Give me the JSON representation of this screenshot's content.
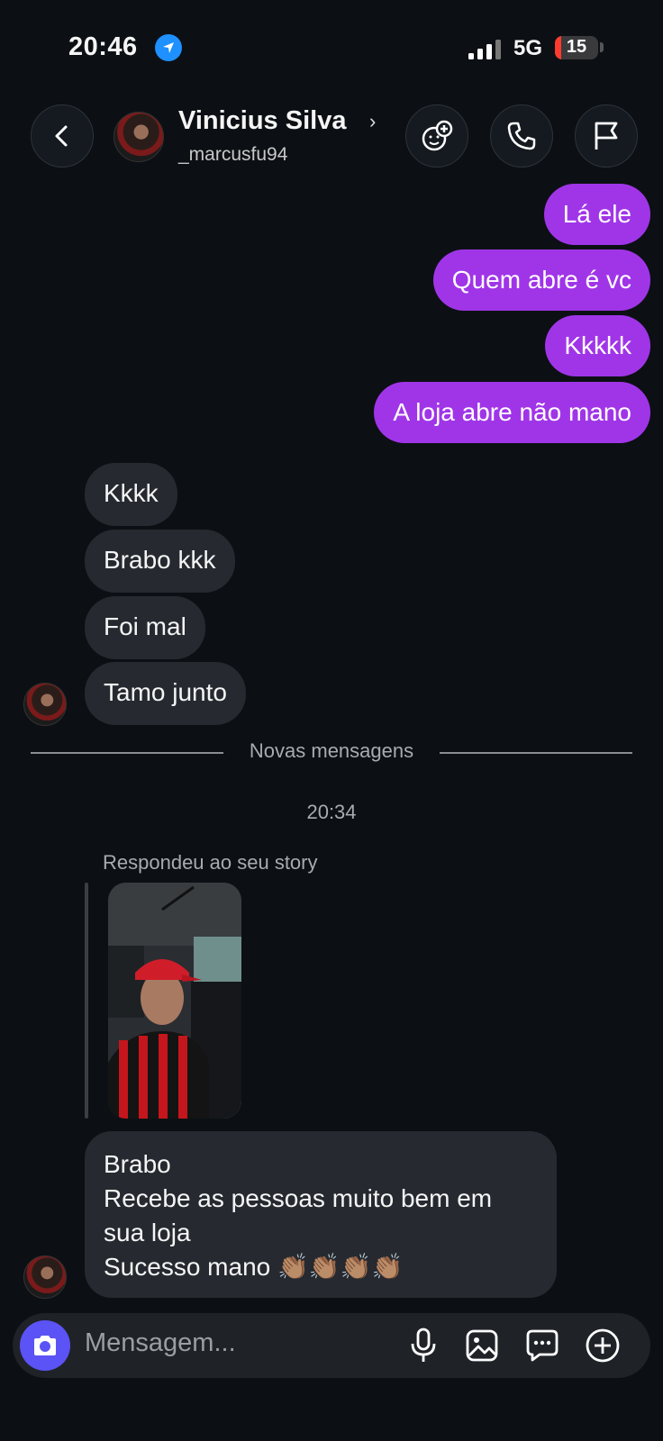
{
  "status_bar": {
    "time": "20:46",
    "network": "5G",
    "battery": "15",
    "battery_level": 0.15
  },
  "header": {
    "name": "Vinicius Silva",
    "username": "_marcusfu94",
    "icons": [
      "back-icon",
      "avatar",
      "add-effect-icon",
      "phone-icon",
      "flag-icon"
    ]
  },
  "messages_out": [
    "Lá ele",
    "Quem abre é vc",
    "Kkkkk",
    "A loja abre não mano"
  ],
  "messages_in": [
    "Kkkk",
    "Brabo kkk",
    "Foi mal",
    "Tamo junto"
  ],
  "divider": "Novas mensagens",
  "timestamp": "20:34",
  "story_reply": {
    "label": "Respondeu ao seu story",
    "lines": [
      "Brabo",
      "Recebe as pessoas muito bem em",
      "sua loja",
      "Sucesso mano 👏🏽👏🏽👏🏽👏🏽"
    ]
  },
  "composer": {
    "placeholder": "Mensagem...",
    "icons": [
      "camera-icon",
      "microphone-icon",
      "image-icon",
      "sticker-icon",
      "add-icon"
    ]
  },
  "colors": {
    "background": "#0c1014",
    "outgoing": "#a035e8",
    "incoming": "#262a30",
    "camera_button": "#5b53f5"
  }
}
